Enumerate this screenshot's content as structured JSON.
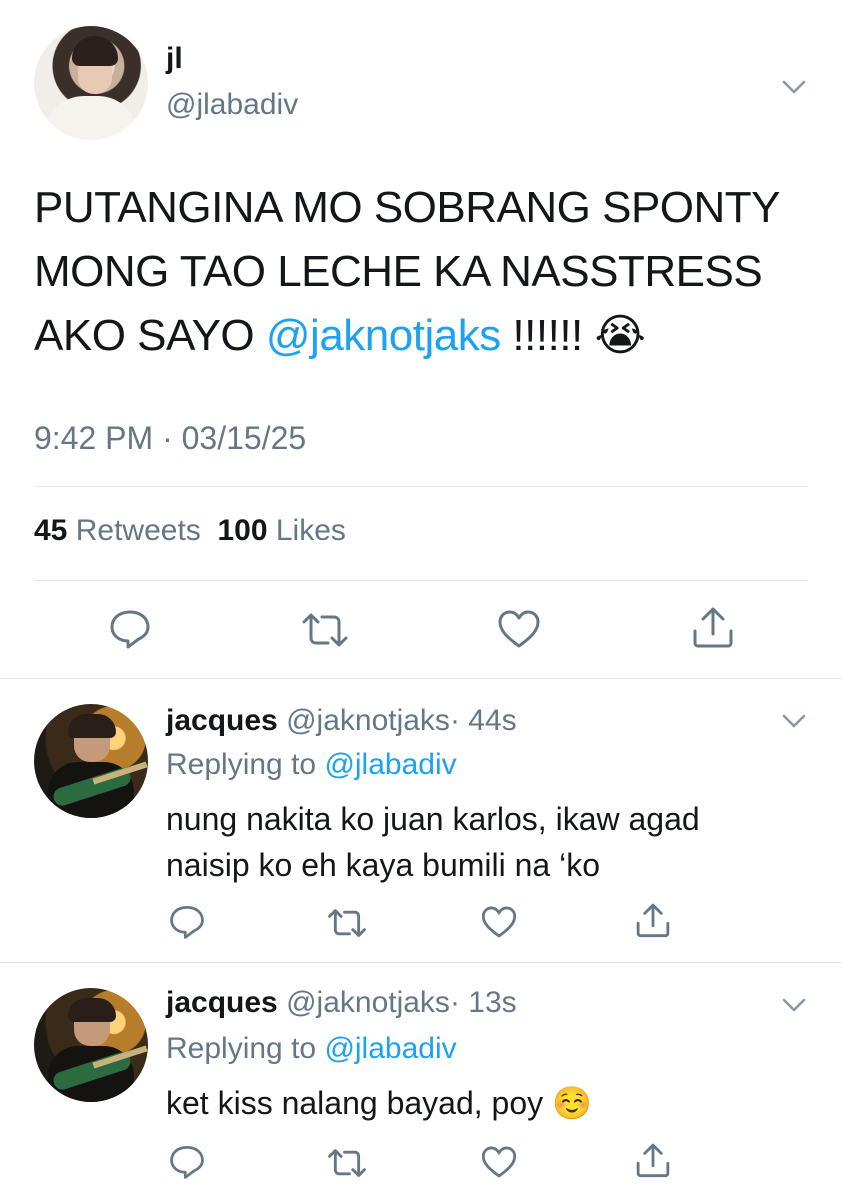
{
  "tweet": {
    "author_name": "jl",
    "author_handle": "@jlabadiv",
    "text_lines": [
      "PUTANGINA MO SOBRANG SPONTY",
      "MONG TAO LECHE KA NASSTRESS",
      "AKO SAYO "
    ],
    "mention": "@jaknotjaks",
    "text_suffix": " !!!!!! ",
    "emoji": "😭",
    "timestamp": "9:42 PM · 03/15/25",
    "retweets_count": "45",
    "retweets_label": "Retweets",
    "likes_count": "100",
    "likes_label": "Likes"
  },
  "replies": [
    {
      "name": "jacques",
      "handle": "@jaknotjaks",
      "time": "· 44s",
      "replying_prefix": "Replying to ",
      "replying_to": "@jlabadiv",
      "text_lines": [
        "nung nakita ko juan karlos, ikaw agad",
        "naisip ko eh kaya bumili na ‘ko"
      ]
    },
    {
      "name": "jacques",
      "handle": "@jaknotjaks",
      "time": "· 13s",
      "replying_prefix": "Replying to ",
      "replying_to": "@jlabadiv",
      "text_lines": [
        "ket kiss nalang bayad, poy "
      ],
      "emoji": "☺️"
    }
  ],
  "icons": {
    "reply": "reply-icon",
    "retweet": "retweet-icon",
    "like": "heart-icon",
    "share": "share-icon",
    "more": "chevron-down-icon"
  },
  "colors": {
    "accent": "#1da1f2",
    "secondary_text": "#657786",
    "primary_text": "#14171a",
    "divider": "#e1e8ed"
  }
}
